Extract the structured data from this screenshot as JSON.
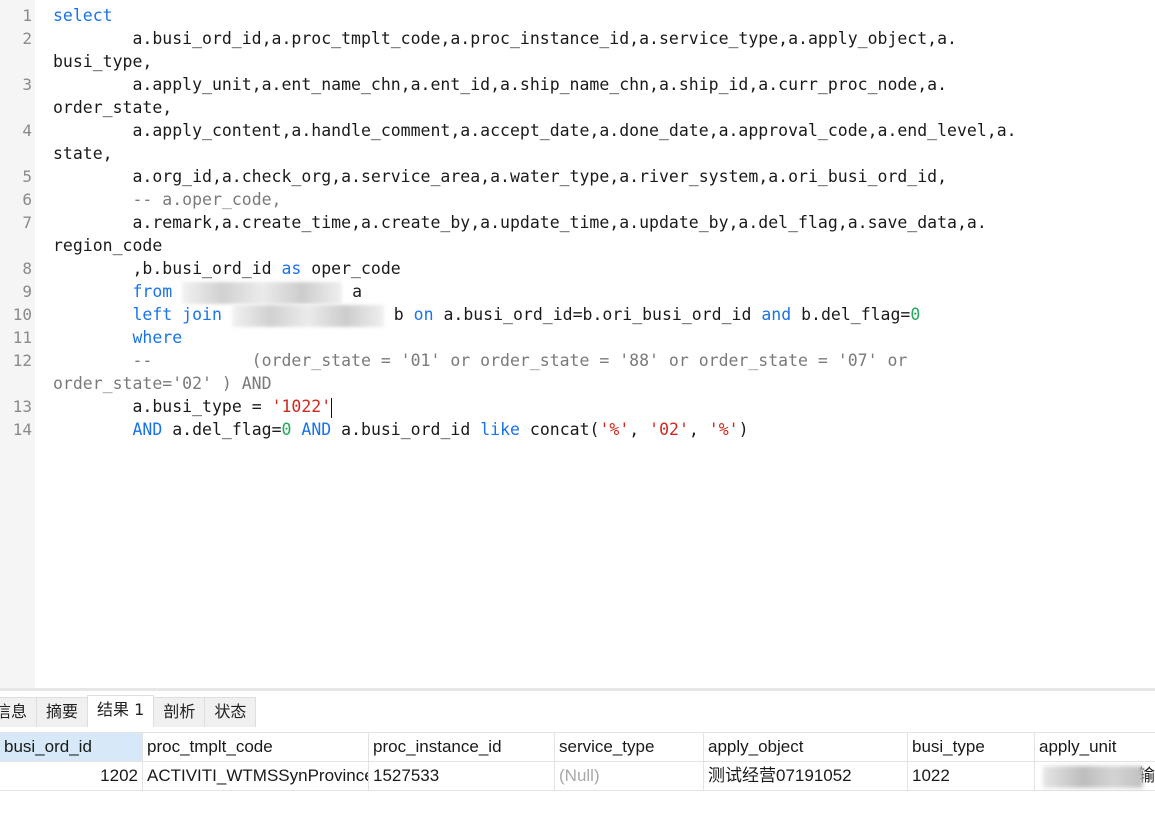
{
  "editor": {
    "line_numbers": [
      "1",
      "2",
      "3",
      "4",
      "5",
      "6",
      "7",
      "8",
      "9",
      "10",
      "11",
      "12",
      "13",
      "14"
    ],
    "line1": {
      "kw": "select"
    },
    "line2": {
      "a": "        a.busi_ord_id,a.proc_tmplt_code,a.proc_instance_id,a.service_type,a.apply_object,a.",
      "b": "busi_type,"
    },
    "line3": {
      "a": "        a.apply_unit,a.ent_name_chn,a.ent_id,a.ship_name_chn,a.ship_id,a.curr_proc_node,a.",
      "b": "order_state,"
    },
    "line4": {
      "a": "        a.apply_content,a.handle_comment,a.accept_date,a.done_date,a.approval_code,a.end_level,a.",
      "b": "state,"
    },
    "line5": {
      "a": "        a.org_id,a.check_org,a.service_area,a.water_type,a.river_system,a.ori_busi_ord_id,"
    },
    "line6": {
      "indent": "        ",
      "comment": "-- a.oper_code,"
    },
    "line7": {
      "a": "        a.remark,a.create_time,a.create_by,a.update_time,a.update_by,a.del_flag,a.save_data,a.",
      "b": "region_code"
    },
    "line8": {
      "indent": "        ",
      "pre": ",b.busi_ord_id ",
      "kw": "as",
      "post": " oper_code"
    },
    "line9": {
      "indent": "        ",
      "kw": "from",
      "alias": "a"
    },
    "line10": {
      "indent": "        ",
      "kw1": "left join",
      "alias": "b ",
      "kw2": "on",
      "mid": " a.busi_ord_id=b.ori_busi_ord_id ",
      "kw3": "and",
      "mid2": " b.del_flag=",
      "num": "0"
    },
    "line11": {
      "indent": "        ",
      "kw": "where"
    },
    "line12": {
      "a": "        --          (order_state = '01' or order_state = '88' or order_state = '07' or",
      "b": "order_state='02' ) AND"
    },
    "line13": {
      "indent": "        ",
      "pre": "a.busi_type = ",
      "str": "'1022'"
    },
    "line14": {
      "indent": "        ",
      "kw1": "AND",
      "t1": " a.del_flag=",
      "num": "0",
      "sp": " ",
      "kw2": "AND",
      "t2": " a.busi_ord_id ",
      "kw3": "like",
      "t3": " concat(",
      "s1": "'%'",
      "c1": ", ",
      "s2": "'02'",
      "c2": ", ",
      "s3": "'%'",
      "t4": ")"
    }
  },
  "results": {
    "tabs": [
      "信息",
      "摘要",
      "结果 1",
      "剖析",
      "状态"
    ],
    "active_tab": "结果 1",
    "columns": [
      "busi_ord_id",
      "proc_tmplt_code",
      "proc_instance_id",
      "service_type",
      "apply_object",
      "busi_type",
      "apply_unit"
    ],
    "row": {
      "busi_ord_id": "1202",
      "proc_tmplt_code": "ACTIVITI_WTMSSynProvince",
      "proc_instance_id": "1527533",
      "service_type": "(Null)",
      "apply_object": "测试经营07191052",
      "busi_type": "1022",
      "apply_unit_tail": "输"
    }
  },
  "colors": {
    "keyword": "#1a73e8",
    "string": "#d0281e",
    "number": "#21a85a",
    "comment": "#7a7a7a",
    "selected_header": "#d7e9f8"
  }
}
